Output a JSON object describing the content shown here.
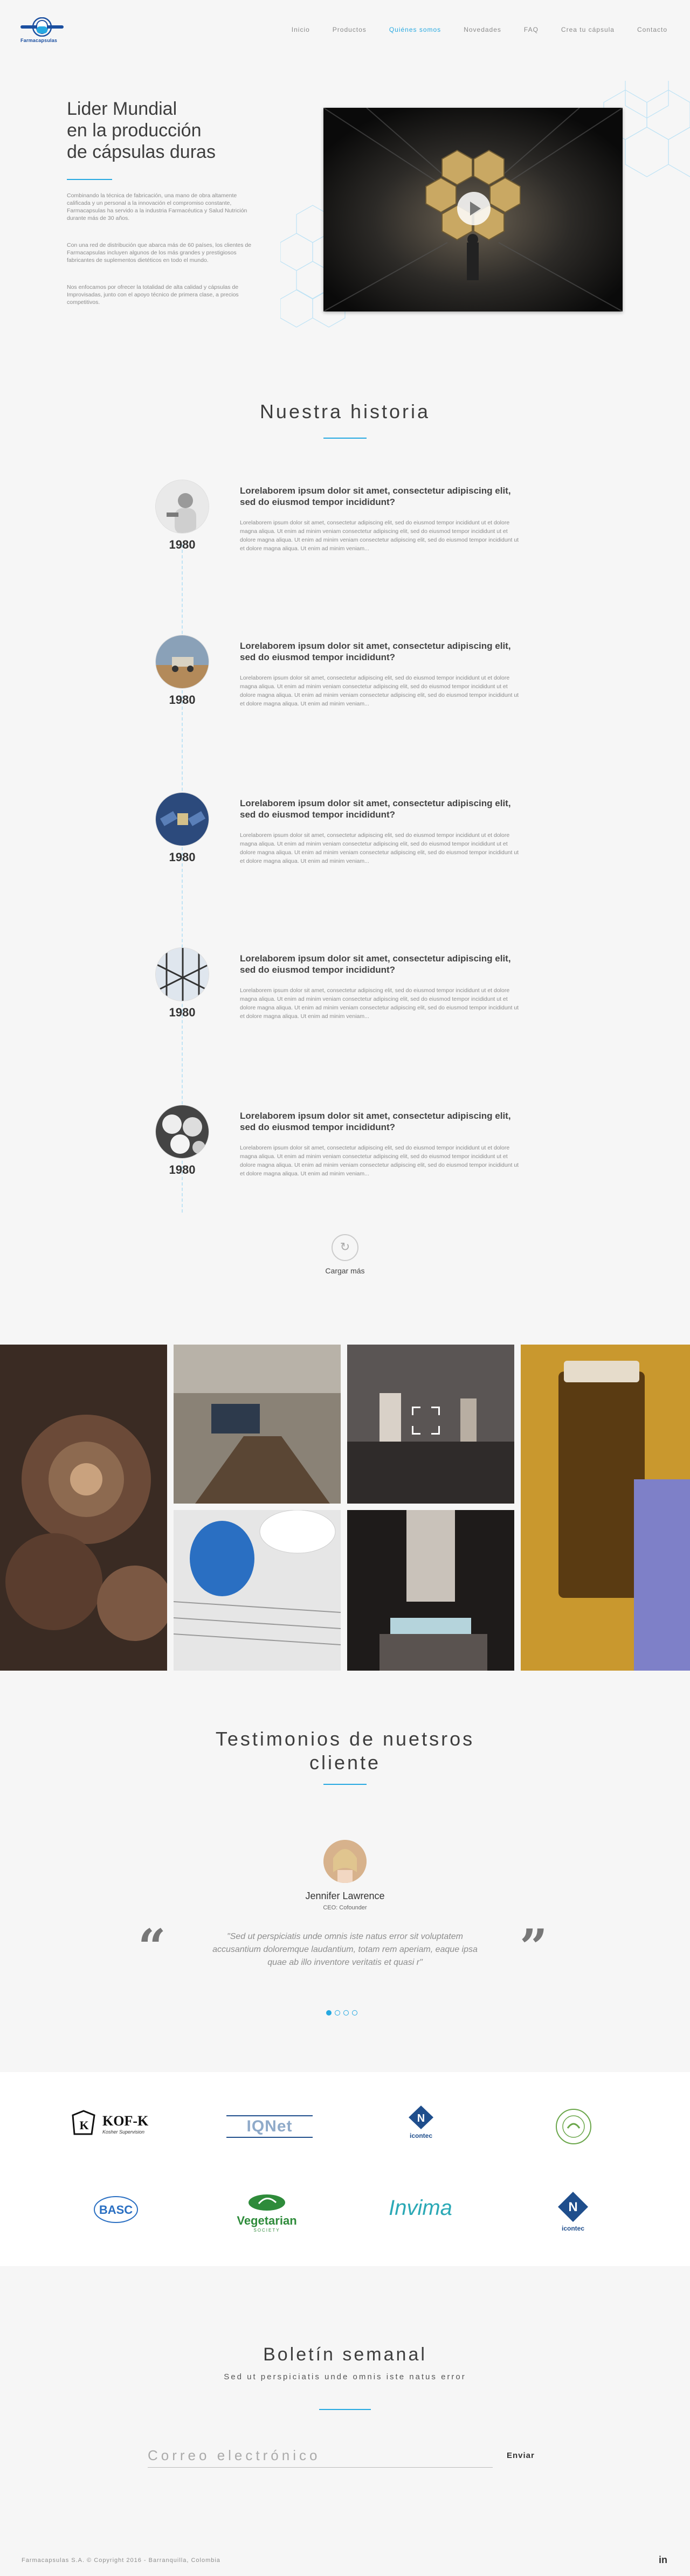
{
  "header": {
    "logo_text": "Farmacapsulas",
    "nav": [
      {
        "label": "Inicio",
        "active": false
      },
      {
        "label": "Productos",
        "active": false
      },
      {
        "label": "Quiénes somos",
        "active": true
      },
      {
        "label": "Novedades",
        "active": false
      },
      {
        "label": "FAQ",
        "active": false
      },
      {
        "label": "Crea tu cápsula",
        "active": false
      },
      {
        "label": "Contacto",
        "active": false
      }
    ]
  },
  "hero": {
    "title_line1": "Lider Mundial",
    "title_line2": "en la producción",
    "title_line3": "de cápsulas duras",
    "p1": "Combinando la técnica de fabricación, una mano de obra altamente calificada y un personal a la innovación el compromiso constante, Farmacapsulas ha servido a la industria Farmacéutica y Salud Nutrición durante más de 30 años.",
    "p2": "Con una red de distribución que abarca más de 60 países, los clientes de Farmacapsulas incluyen algunos de los más grandes y prestigiosos fabricantes de suplementos dietéticos en todo el mundo.",
    "p3": "Nos enfocamos por ofrecer la totalidad de alta calidad y cápsulas de Improvisadas, junto con el apoyo técnico de primera clase, a precios competitivos."
  },
  "history": {
    "title": "Nuestra historia",
    "items": [
      {
        "year": "1980",
        "heading": "Lorelaborem ipsum dolor sit amet, consectetur adipiscing elit, sed do eiusmod tempor incididunt?",
        "body": "Lorelaborem ipsum dolor sit amet, consectetur adipiscing elit, sed do eiusmod tempor incididunt ut et dolore magna aliqua. Ut enim ad minim veniam consectetur adipiscing elit, sed do eiusmod tempor incididunt ut et dolore magna aliqua. Ut enim ad minim veniam consectetur adipiscing elit, sed do eiusmod tempor incididunt ut et dolore magna aliqua. Ut enim ad minim veniam..."
      },
      {
        "year": "1980",
        "heading": "Lorelaborem ipsum dolor sit amet, consectetur adipiscing elit, sed do eiusmod tempor incididunt?",
        "body": "Lorelaborem ipsum dolor sit amet, consectetur adipiscing elit, sed do eiusmod tempor incididunt ut et dolore magna aliqua. Ut enim ad minim veniam consectetur adipiscing elit, sed do eiusmod tempor incididunt ut et dolore magna aliqua. Ut enim ad minim veniam consectetur adipiscing elit, sed do eiusmod tempor incididunt ut et dolore magna aliqua. Ut enim ad minim veniam..."
      },
      {
        "year": "1980",
        "heading": "Lorelaborem ipsum dolor sit amet, consectetur adipiscing elit, sed do eiusmod tempor incididunt?",
        "body": "Lorelaborem ipsum dolor sit amet, consectetur adipiscing elit, sed do eiusmod tempor incididunt ut et dolore magna aliqua. Ut enim ad minim veniam consectetur adipiscing elit, sed do eiusmod tempor incididunt ut et dolore magna aliqua. Ut enim ad minim veniam consectetur adipiscing elit, sed do eiusmod tempor incididunt ut et dolore magna aliqua. Ut enim ad minim veniam..."
      },
      {
        "year": "1980",
        "heading": "Lorelaborem ipsum dolor sit amet, consectetur adipiscing elit, sed do eiusmod tempor incididunt?",
        "body": "Lorelaborem ipsum dolor sit amet, consectetur adipiscing elit, sed do eiusmod tempor incididunt ut et dolore magna aliqua. Ut enim ad minim veniam consectetur adipiscing elit, sed do eiusmod tempor incididunt ut et dolore magna aliqua. Ut enim ad minim veniam consectetur adipiscing elit, sed do eiusmod tempor incididunt ut et dolore magna aliqua. Ut enim ad minim veniam..."
      },
      {
        "year": "1980",
        "heading": "Lorelaborem ipsum dolor sit amet, consectetur adipiscing elit, sed do eiusmod tempor incididunt?",
        "body": "Lorelaborem ipsum dolor sit amet, consectetur adipiscing elit, sed do eiusmod tempor incididunt ut et dolore magna aliqua. Ut enim ad minim veniam consectetur adipiscing elit, sed do eiusmod tempor incididunt ut et dolore magna aliqua. Ut enim ad minim veniam consectetur adipiscing elit, sed do eiusmod tempor incididunt ut et dolore magna aliqua. Ut enim ad minim veniam..."
      }
    ],
    "load_more": "Cargar más"
  },
  "testimonials": {
    "title_line1": "Testimonios de nuetsros",
    "title_line2": "cliente",
    "name": "Jennifer Lawrence",
    "role": "CEO: Cofounder",
    "quote": "\"Sed ut perspiciatis unde omnis iste natus error sit voluptatem accusantium doloremque laudantium, totam rem aperiam, eaque ipsa quae ab illo inventore veritatis et quasi r\"",
    "open_quote": "“",
    "close_quote": "”"
  },
  "partners": {
    "kofk": "KOF-K",
    "kofk_sub": "Kosher Supervision",
    "iqnet": "IQNet",
    "icontec": "icontec",
    "bas": "BASC",
    "vegetarian": "Vegetarian",
    "vegetarian_sub": "SOCIETY",
    "invima": "Invima",
    "icontec2": "icontec"
  },
  "newsletter": {
    "title": "Boletín semanal",
    "subtitle": "Sed ut perspiciatis unde omnis iste natus error",
    "placeholder": "Correo electrónico",
    "send": "Enviar"
  },
  "footer": {
    "copyright": "Farmacapsulas S.A. © Copyright 2016 - Barranquilla, Colombia",
    "linkedin": "in"
  },
  "colors": {
    "accent": "#27a9e1",
    "heading": "#3e3e3e"
  }
}
